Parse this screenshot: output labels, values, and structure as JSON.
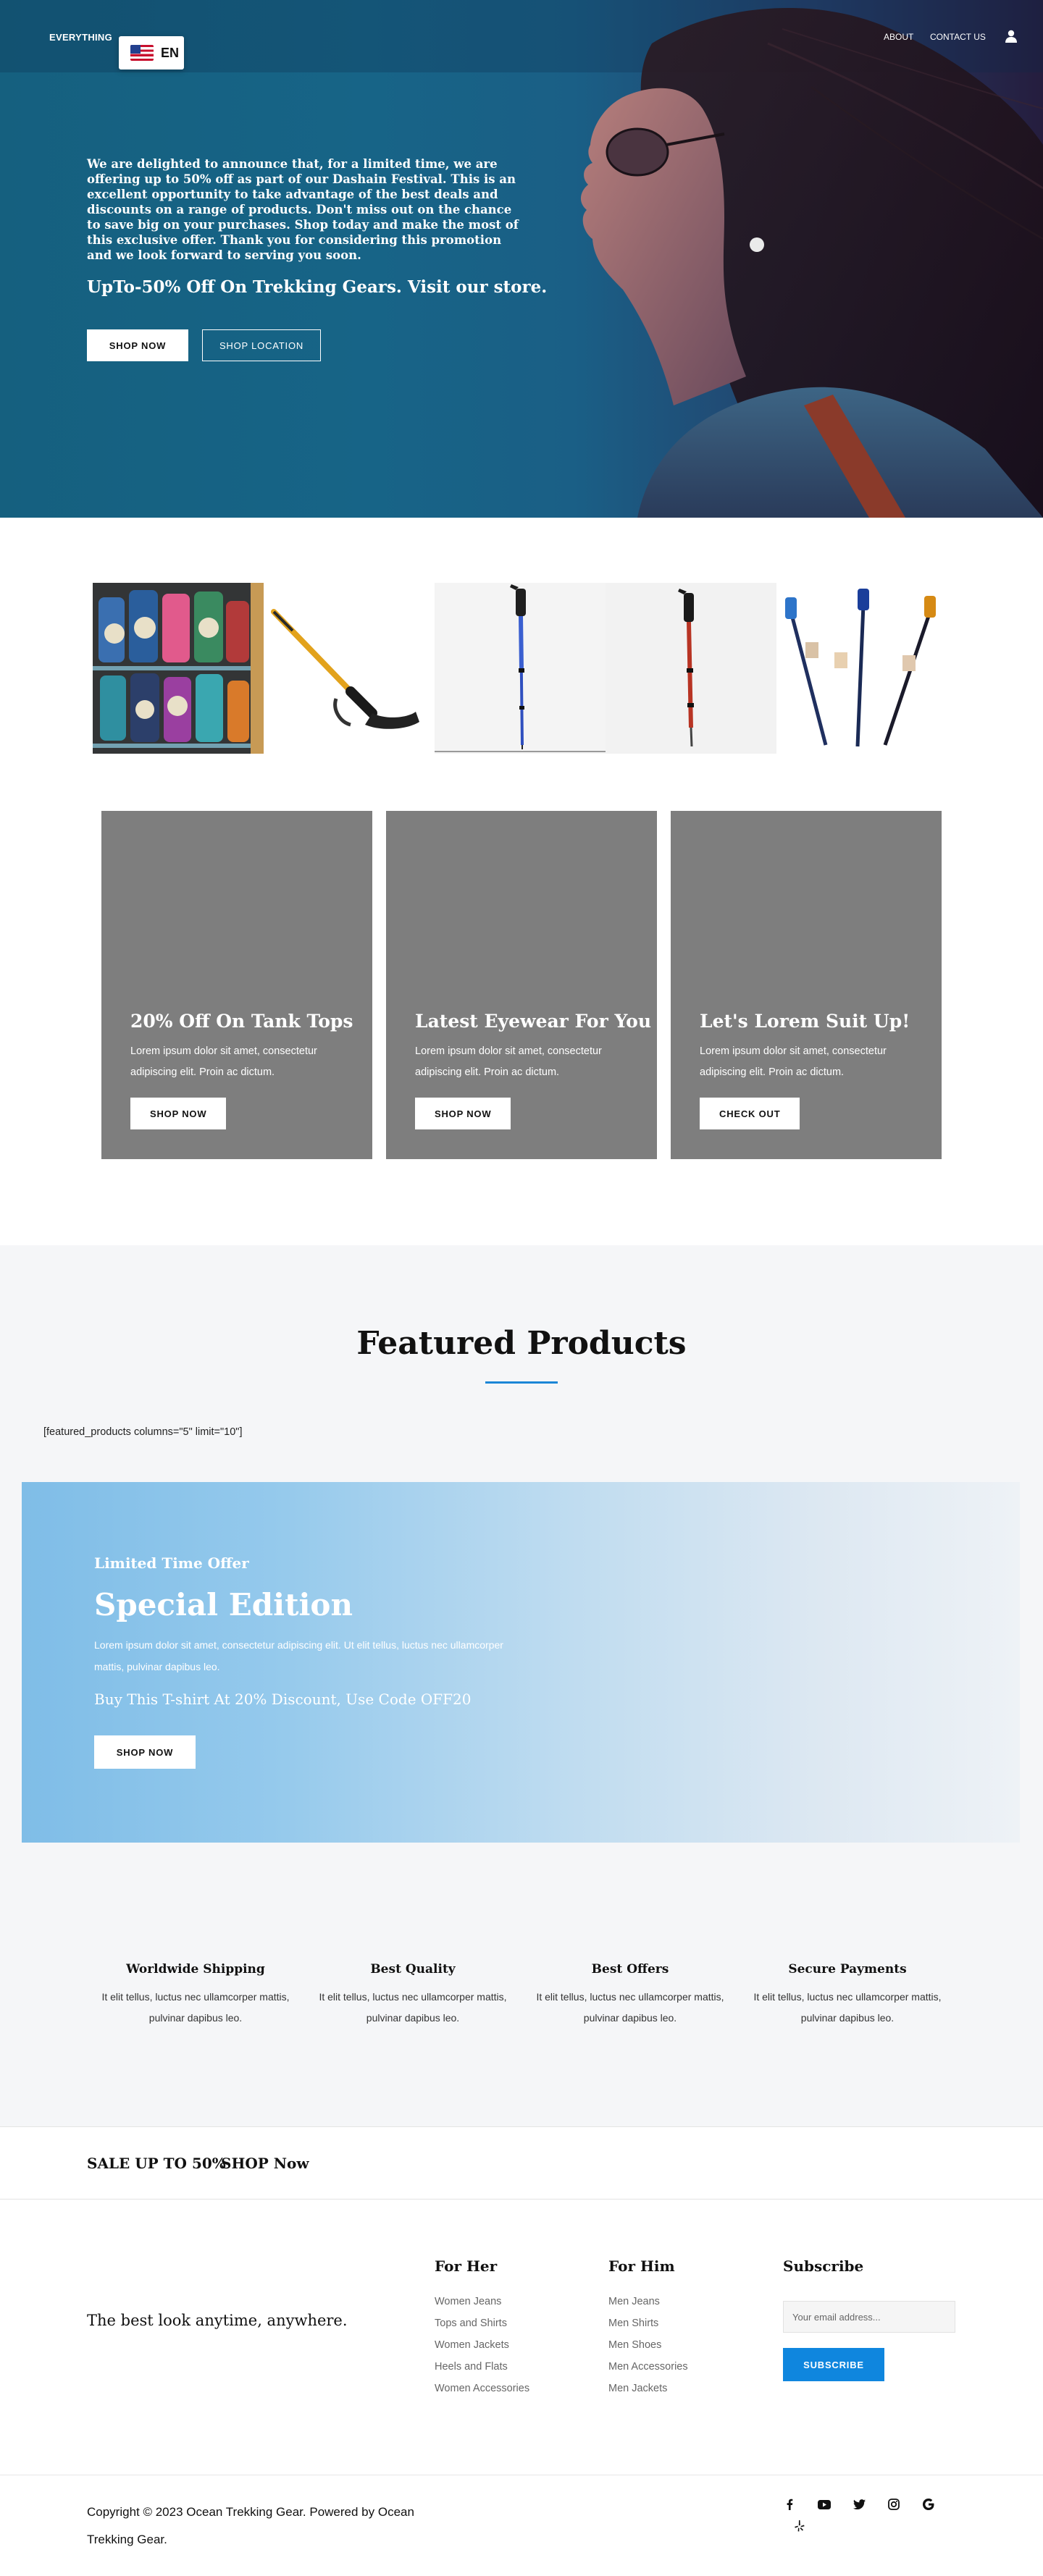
{
  "header": {
    "brand": "EVERYTHING",
    "language": "EN",
    "nav": {
      "about": "ABOUT",
      "contact": "CONTACT US"
    },
    "icons": {
      "language_flag": "us-flag-icon",
      "account": "user-icon"
    }
  },
  "hero": {
    "text": "We are delighted to announce that, for a limited time, we are offering up to 50% off as part of our Dashain Festival. This is an excellent opportunity to take advantage of the best deals and discounts on a range of products. Don't miss out on the chance to save big on your purchases. Shop today and make the most of this exclusive offer. Thank you for considering this promotion and we look forward to serving you soon.",
    "offer": "UpTo-50% Off On Trekking Gears. Visit our store.",
    "shop_now": "SHOP NOW",
    "shop_location": "SHOP LOCATION"
  },
  "products": [
    {
      "image": "water-bottles-display"
    },
    {
      "image": "orange-trekking-pole"
    },
    {
      "image": "blue-trekking-pole"
    },
    {
      "image": "red-trekking-pole"
    },
    {
      "image": "trekking-pole-set"
    }
  ],
  "promo_cards": [
    {
      "title": "20% Off On Tank Tops",
      "text": "Lorem ipsum dolor sit amet, consectetur adipiscing elit. Proin ac dictum.",
      "button": "SHOP NOW"
    },
    {
      "title": "Latest Eyewear For You",
      "text": "Lorem ipsum dolor sit amet, consectetur adipiscing elit. Proin ac dictum.",
      "button": "SHOP NOW"
    },
    {
      "title": "Let's Lorem Suit Up!",
      "text": "Lorem ipsum dolor sit amet, consectetur adipiscing elit. Proin ac dictum.",
      "button": "CHECK OUT"
    }
  ],
  "featured": {
    "title": "Featured Products",
    "shortcode": "[featured_products columns=\"5\" limit=\"10\"]",
    "accent_color": "#1b86d6"
  },
  "banner": {
    "kicker": "Limited Time Offer",
    "title": "Special Edition",
    "text": "Lorem ipsum dolor sit amet, consectetur adipiscing elit. Ut elit tellus, luctus nec ullamcorper mattis, pulvinar dapibus leo.",
    "code": "Buy This T-shirt At 20% Discount, Use Code OFF20",
    "button": "SHOP NOW"
  },
  "features": [
    {
      "title": "Worldwide Shipping",
      "text": "It elit tellus, luctus nec ullamcorper mattis, pulvinar dapibus leo."
    },
    {
      "title": "Best Quality",
      "text": "It elit tellus, luctus nec ullamcorper mattis, pulvinar dapibus leo."
    },
    {
      "title": "Best Offers",
      "text": "It elit tellus, luctus nec ullamcorper mattis, pulvinar dapibus leo."
    },
    {
      "title": "Secure Payments",
      "text": "It elit tellus, luctus nec ullamcorper mattis, pulvinar dapibus leo."
    }
  ],
  "sale_bar": {
    "label": "SALE UP TO 50%",
    "link": "SHOP Now"
  },
  "footer": {
    "tagline": "The best look anytime, anywhere.",
    "for_her": {
      "title": "For Her",
      "links": [
        "Women Jeans",
        "Tops and Shirts",
        "Women Jackets",
        "Heels and Flats",
        "Women Accessories"
      ]
    },
    "for_him": {
      "title": "For Him",
      "links": [
        "Men Jeans",
        "Men Shirts",
        "Men Shoes",
        "Men Accessories",
        "Men Jackets"
      ]
    },
    "subscribe": {
      "title": "Subscribe",
      "placeholder": "Your email address...",
      "button": "SUBSCRIBE",
      "button_color": "#0f86de"
    },
    "copyright": "Copyright © 2023 Ocean Trekking Gear. Powered by Ocean Trekking Gear.",
    "social": [
      "facebook-icon",
      "youtube-icon",
      "twitter-icon",
      "instagram-icon",
      "google-icon",
      "yelp-icon"
    ]
  }
}
